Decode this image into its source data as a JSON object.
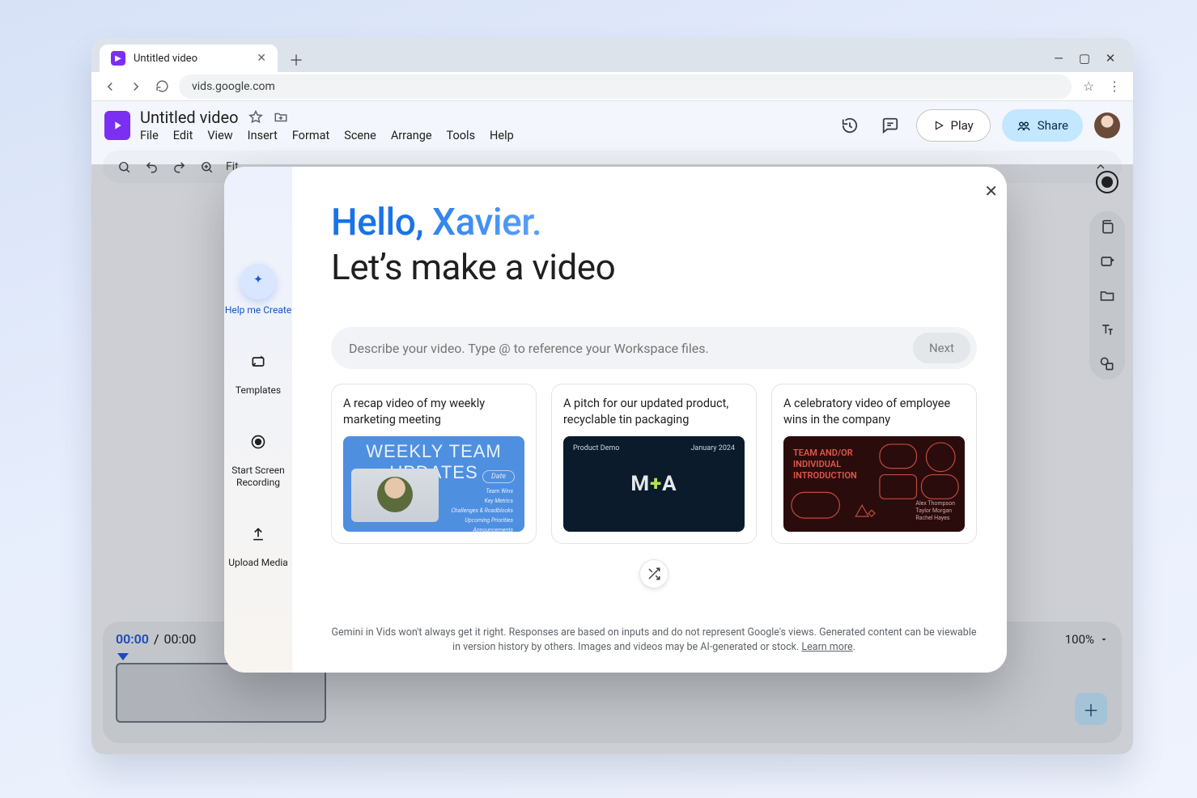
{
  "browser": {
    "tab_title": "Untitled video",
    "url": "vids.google.com"
  },
  "app": {
    "doc_title": "Untitled video",
    "menus": [
      "File",
      "Edit",
      "View",
      "Insert",
      "Format",
      "Scene",
      "Arrange",
      "Tools",
      "Help"
    ],
    "play": "Play",
    "share": "Share",
    "toolbar_fit": "Fit"
  },
  "timeline": {
    "current": "00:00",
    "sep": " / ",
    "total": "00:00",
    "zoom": "100%"
  },
  "modal": {
    "side": {
      "help": "Help me Create",
      "templates": "Templates",
      "record": "Start Screen Recording",
      "upload": "Upload Media"
    },
    "hello1": "Hello, ",
    "hello2": "Xavier.",
    "sub": "Let’s make a video",
    "placeholder": "Describe your video. Type @ to reference your Workspace files.",
    "next": "Next",
    "cards": [
      {
        "title": "A recap video of my weekly marketing meeting",
        "thumb": {
          "banner": "WEEKLY TEAM UPDATES",
          "date": "Date",
          "lines": [
            "Team Wins",
            "Key Metrics",
            "Challenges & Roadblocks",
            "Upcoming Priorities",
            "Announcements"
          ]
        }
      },
      {
        "title": "A pitch for our updated product, recyclable tin packaging",
        "thumb": {
          "tl": "Product Demo",
          "tr": "January 2024",
          "logo_a": "M",
          "logo_plus": "+",
          "logo_b": "A"
        }
      },
      {
        "title": "A celebratory video of employee wins in the company",
        "thumb": {
          "title": "TEAM AND/OR INDIVIDUAL INTRODUCTION",
          "names": "Alex Thompson\nTaylor Morgan\nRachel Hayes"
        }
      }
    ],
    "legal": "Gemini in Vids won't always get it right. Responses are based on inputs and do not represent Google's views. Generated content can be viewable in version history by others. Images and videos may be AI-generated or stock. ",
    "learn": "Learn more"
  }
}
